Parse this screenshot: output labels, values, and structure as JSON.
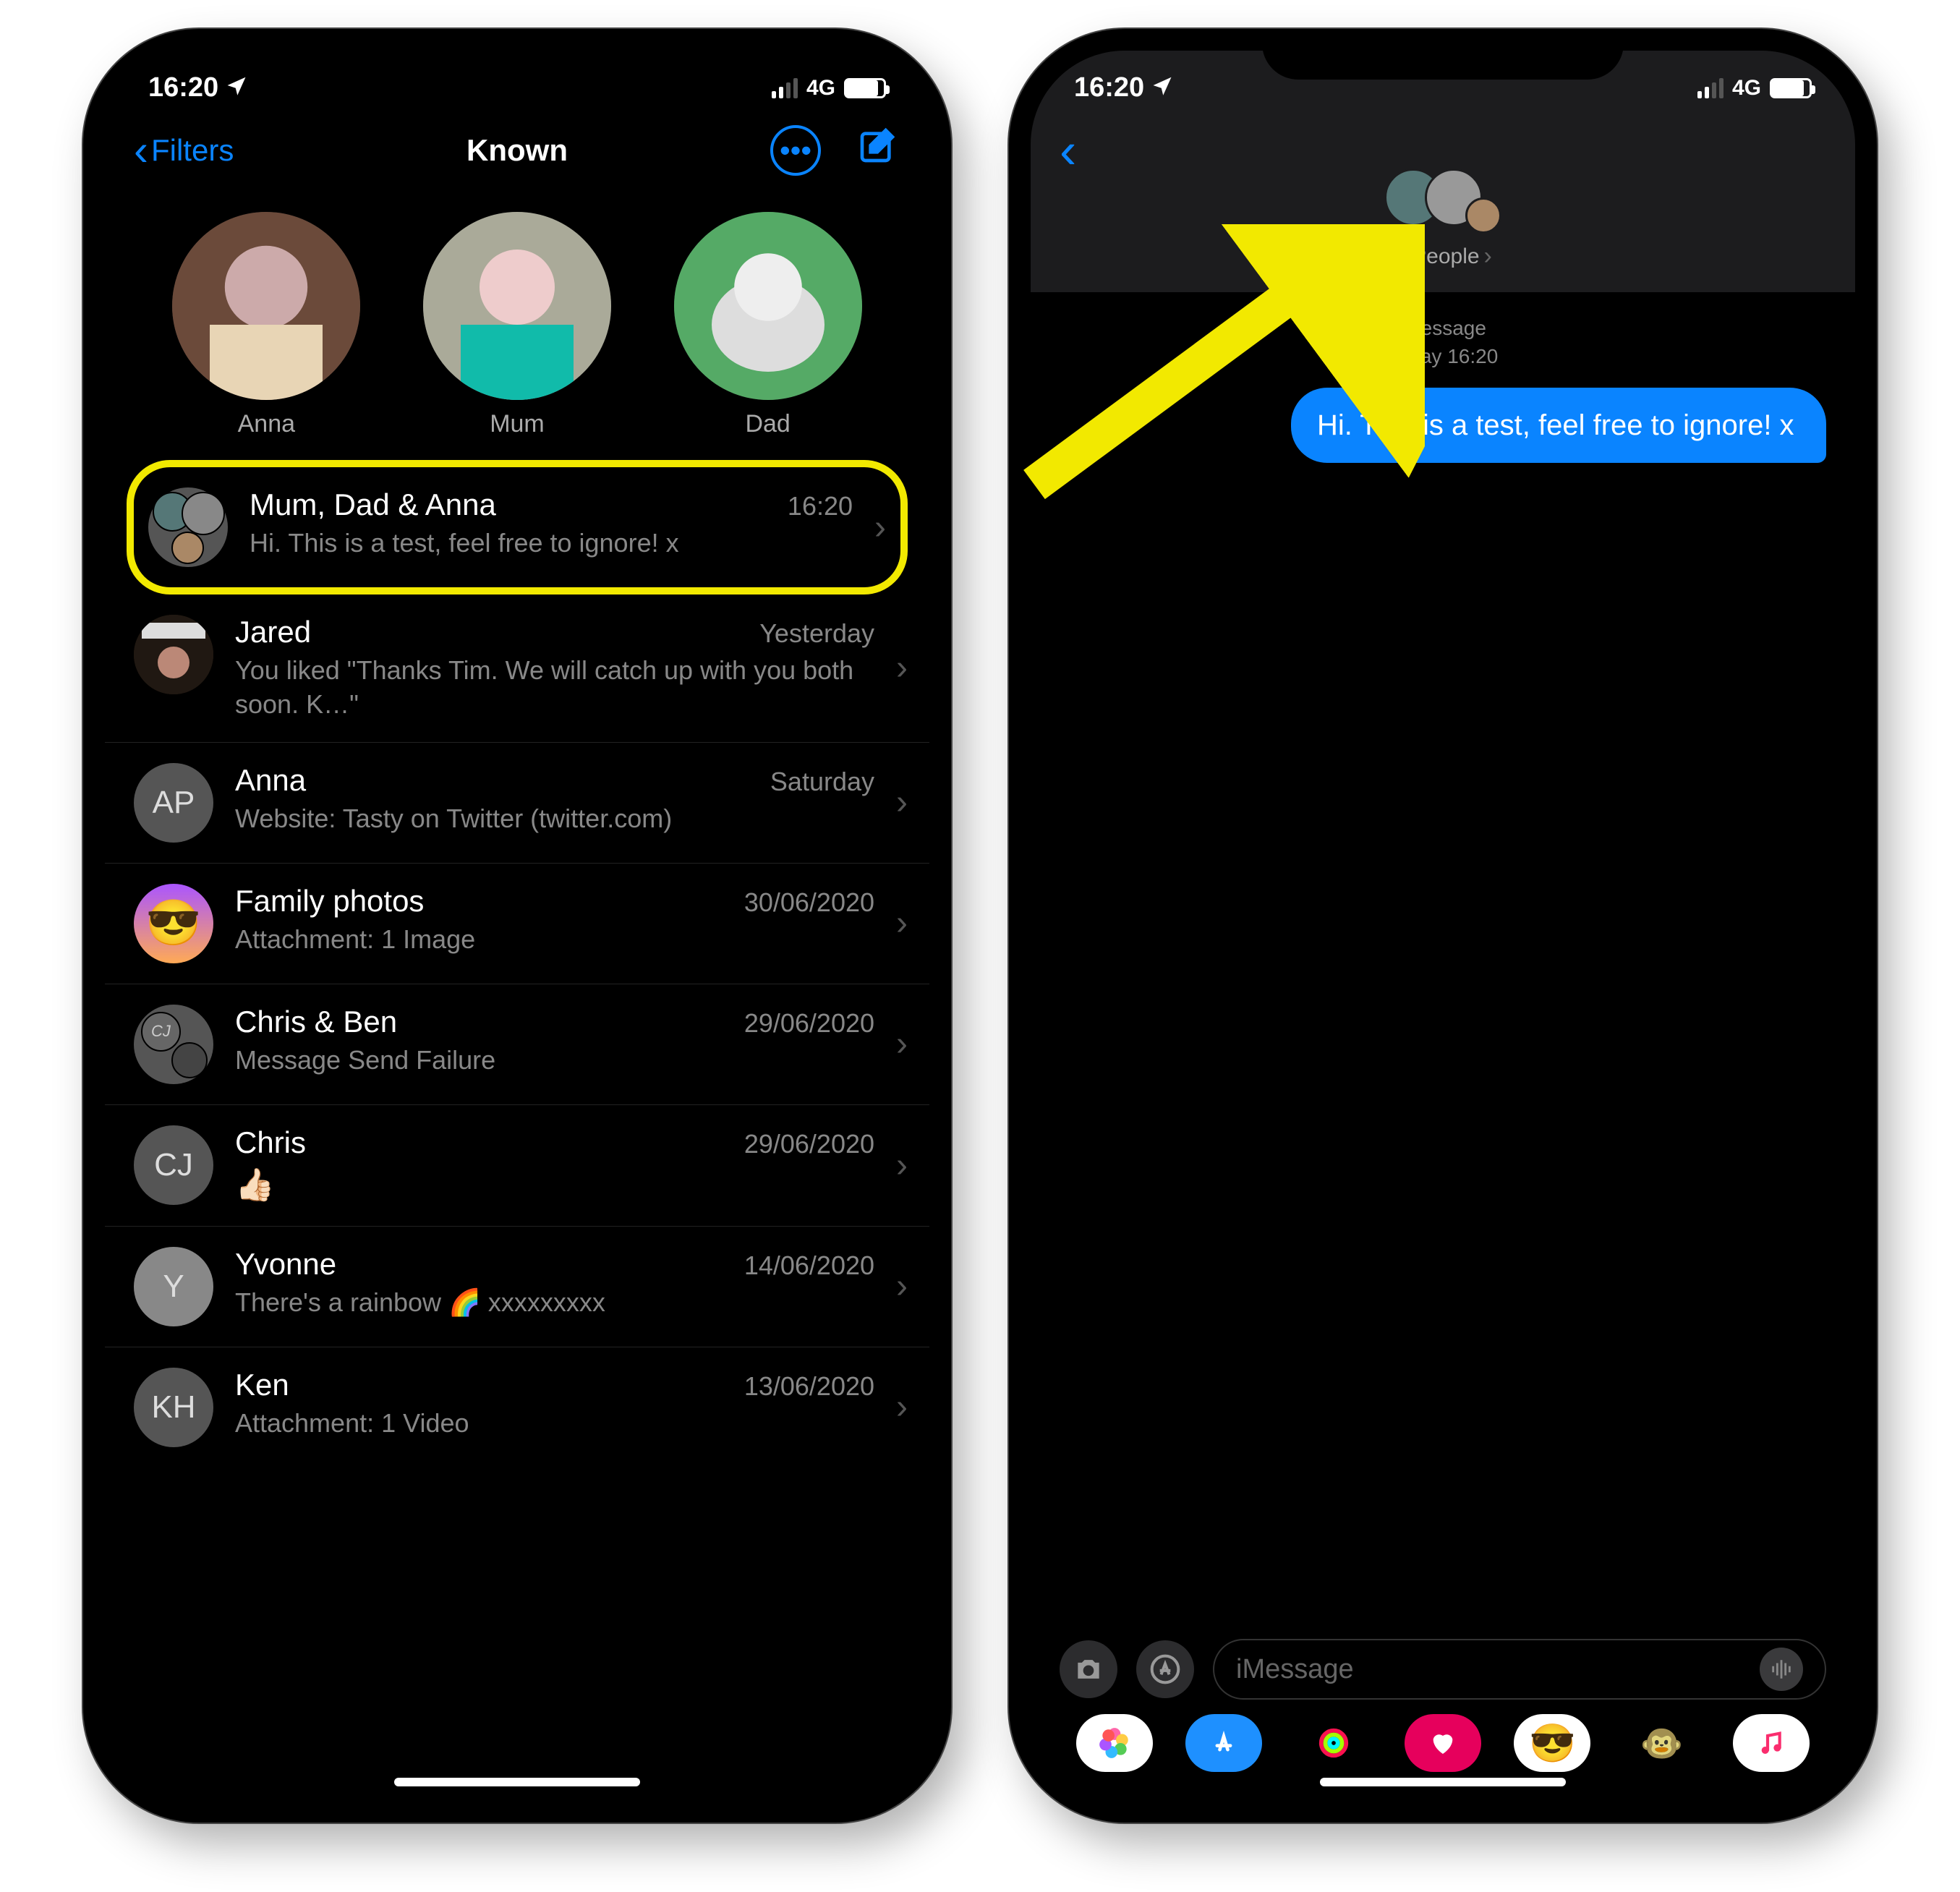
{
  "status": {
    "time": "16:20",
    "network": "4G"
  },
  "left": {
    "filters_label": "Filters",
    "title": "Known",
    "pins": [
      {
        "name": "Anna"
      },
      {
        "name": "Mum"
      },
      {
        "name": "Dad"
      }
    ],
    "rows": [
      {
        "name": "Mum, Dad & Anna",
        "time": "16:20",
        "preview": "Hi. This is a test, feel free to ignore! x",
        "avatar": "group",
        "highlight": true
      },
      {
        "name": "Jared",
        "time": "Yesterday",
        "preview": "You liked \"Thanks Tim. We will catch up with you both soon. K…\"",
        "avatar": "photo"
      },
      {
        "name": "Anna",
        "time": "Saturday",
        "preview": "Website: Tasty on Twitter (twitter.com)",
        "avatar": "AP"
      },
      {
        "name": "Family photos",
        "time": "30/06/2020",
        "preview": "Attachment: 1 Image",
        "avatar": "😎"
      },
      {
        "name": "Chris & Ben",
        "time": "29/06/2020",
        "preview": "Message Send Failure",
        "avatar": "group2"
      },
      {
        "name": "Chris",
        "time": "29/06/2020",
        "preview": "👍🏻",
        "avatar": "CJ"
      },
      {
        "name": "Yvonne",
        "time": "14/06/2020",
        "preview": "There's a rainbow 🌈 xxxxxxxxx",
        "avatar": "Y"
      },
      {
        "name": "Ken",
        "time": "13/06/2020",
        "preview": "Attachment: 1 Video",
        "avatar": "KH"
      }
    ]
  },
  "right": {
    "group_label": "3 People",
    "timestamp_line1": "iMessage",
    "timestamp_line2": "Today 16:20",
    "bubble": "Hi. This is a test, feel free to ignore! x",
    "placeholder": "iMessage"
  }
}
